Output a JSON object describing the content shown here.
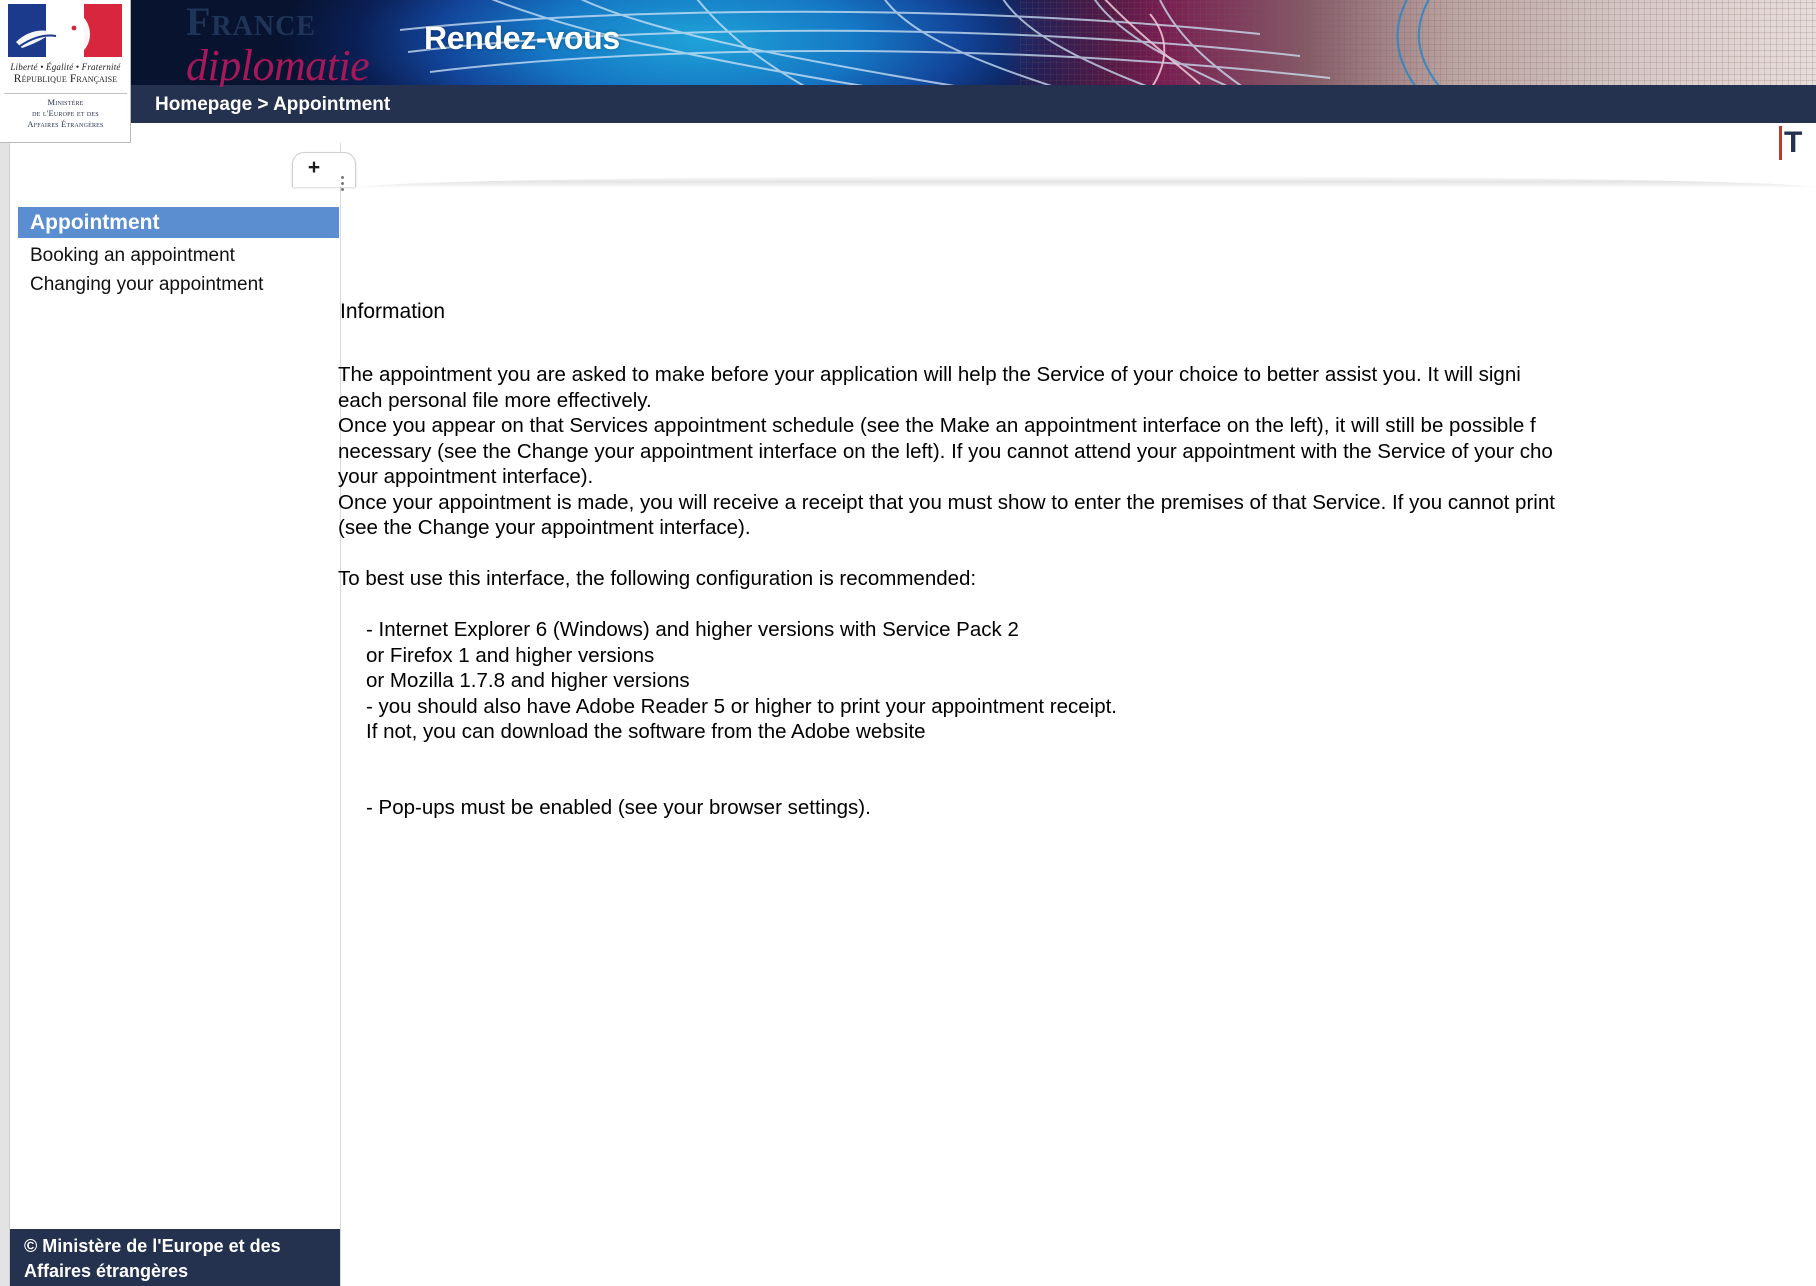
{
  "logo": {
    "devise": "Liberté • Égalité • Fraternité",
    "republic": "République Française",
    "ministry_line1": "Ministère",
    "ministry_line2": "de l'Europe et des",
    "ministry_line3": "Affaires Étrangères"
  },
  "wordmark": {
    "line1": "France",
    "line2": "diplomatie"
  },
  "banner": {
    "title": "Rendez-vous"
  },
  "breadcrumb": {
    "text": "Homepage > Appointment"
  },
  "clipped_heading": {
    "text": "T"
  },
  "panel_tab": {
    "expand_label": "+"
  },
  "sidebar": {
    "header": "Appointment",
    "items": [
      {
        "label": "Booking an appointment"
      },
      {
        "label": "Changing your appointment"
      }
    ]
  },
  "main": {
    "heading": "Information",
    "paragraph1_line1": "    The appointment you are asked to make before your application will help the Service of your choice to better assist you. It will signi",
    "paragraph1_line2": "each personal file more effectively.",
    "paragraph1_line3": "Once you appear on that Services appointment schedule (see the Make an appointment interface on the left), it will still be possible f",
    "paragraph1_line4": "necessary (see the Change your appointment interface on the left). If you cannot attend your appointment with the Service of your cho",
    "paragraph1_line5": "your appointment interface).",
    "paragraph1_line6": "Once your appointment is made, you will receive a receipt that you must show to enter the premises of that Service. If you cannot print",
    "paragraph1_line7": "(see the Change your appointment interface).",
    "config_intro": "To best use this interface, the following configuration is recommended:",
    "config_items": [
      "- Internet Explorer 6 (Windows) and higher versions with Service Pack 2",
      "or Firefox 1 and higher versions",
      "or Mozilla 1.7.8 and higher versions",
      "- you should also have Adobe Reader 5 or higher to print your appointment receipt.",
      "If not, you can download the software from the Adobe website"
    ],
    "popups_note": "- Pop-ups must be enabled (see your browser settings)."
  },
  "footer": {
    "line1": "© Ministère de l'Europe et des",
    "line2": "Affaires étrangères"
  },
  "colors": {
    "banner_navy": "#24314f",
    "sidebar_blue": "#5b8ed0",
    "wordmark_navy": "#1f3557",
    "wordmark_magenta": "#a5185a",
    "flag_blue": "#1b3a8c",
    "flag_red": "#d7263d",
    "gutter_gray": "#e3e3e3"
  }
}
